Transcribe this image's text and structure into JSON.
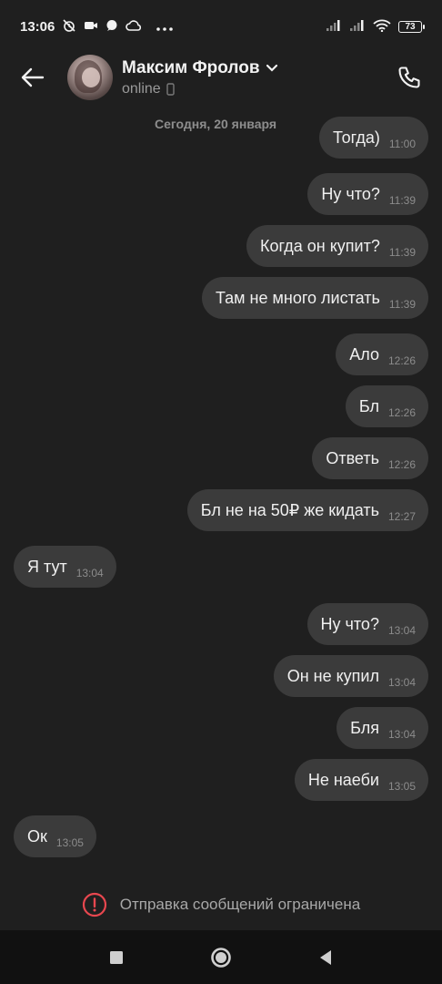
{
  "status_bar": {
    "time": "13:06",
    "battery": "73",
    "icons": [
      "alarm-off-icon",
      "video-icon",
      "chat-icon",
      "cloud-icon",
      "more-icon",
      "signal-icon",
      "signal-icon",
      "wifi-icon",
      "battery-icon"
    ]
  },
  "header": {
    "contact_name": "Максим Фролов",
    "contact_status": "online"
  },
  "chat": {
    "date_separator": "Сегодня, 20 января",
    "messages": [
      {
        "dir": "out",
        "text": "Тогда)",
        "time": "11:00"
      },
      {
        "dir": "out",
        "text": "Ну что?",
        "time": "11:39"
      },
      {
        "dir": "out",
        "text": "Когда он купит?",
        "time": "11:39"
      },
      {
        "dir": "out",
        "text": "Там не много листать",
        "time": "11:39"
      },
      {
        "dir": "out",
        "text": "Ало",
        "time": "12:26"
      },
      {
        "dir": "out",
        "text": "Бл",
        "time": "12:26"
      },
      {
        "dir": "out",
        "text": "Ответь",
        "time": "12:26"
      },
      {
        "dir": "out",
        "text": "Бл не на 50₽ же кидать",
        "time": "12:27"
      },
      {
        "dir": "in",
        "text": "Я тут",
        "time": "13:04"
      },
      {
        "dir": "out",
        "text": "Ну что?",
        "time": "13:04"
      },
      {
        "dir": "out",
        "text": "Он не купил",
        "time": "13:04"
      },
      {
        "dir": "out",
        "text": "Бля",
        "time": "13:04"
      },
      {
        "dir": "out",
        "text": "Не наеби",
        "time": "13:05"
      },
      {
        "dir": "in",
        "text": "Ок",
        "time": "13:05"
      }
    ]
  },
  "footer": {
    "restricted_text": "Отправка сообщений ограничена",
    "alert_color": "#e8474f"
  }
}
